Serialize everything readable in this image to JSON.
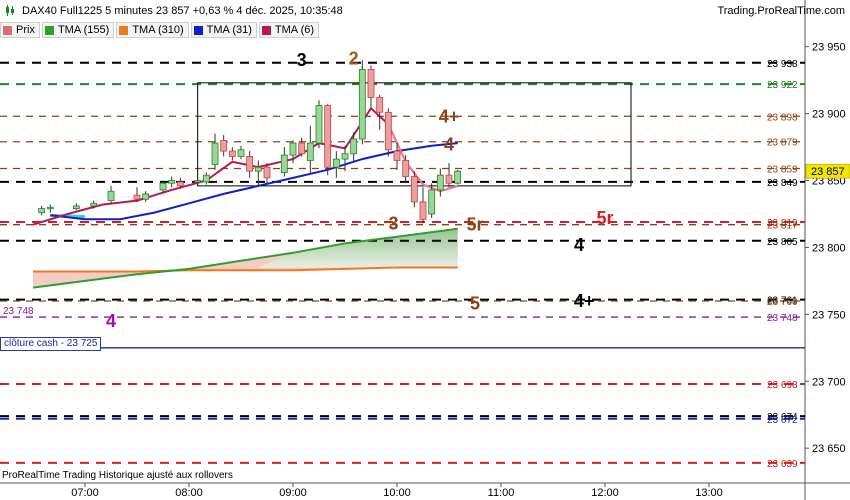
{
  "header": {
    "title": "DAX40 Full1225 5 minutes 23 857 +0,63 % 4 déc. 2025, 10:35:48",
    "brand": "Trading.ProRealTime.com"
  },
  "legend": [
    {
      "label": "Prix",
      "color": "#d97070"
    },
    {
      "label": "TMA (155)",
      "color": "#2e9e2e"
    },
    {
      "label": "TMA (310)",
      "color": "#f07820"
    },
    {
      "label": "TMA (31)",
      "color": "#1020c8"
    },
    {
      "label": "TMA (6)",
      "color": "#b81850"
    }
  ],
  "cash_label": "clôture cash -  23 725",
  "footer": "ProRealTime Trading  Historique ajusté aux rollovers",
  "chart_data": {
    "type": "candlestick",
    "x_ticks": [
      "07:00",
      "08:00",
      "09:00",
      "10:00",
      "11:00",
      "12:00",
      "13:00"
    ],
    "y_ticks": [
      23950,
      23900,
      23850,
      23800,
      23750,
      23700,
      23650
    ],
    "y_tick_labels": [
      "23 950",
      "23 900",
      "23 850",
      "23 800",
      "23 750",
      "23 700",
      "23 650"
    ],
    "ylim": [
      23624,
      23955
    ],
    "last_price": {
      "value": 23857,
      "label": "23 857"
    },
    "candles": [
      {
        "t": "06:35",
        "o": 23826,
        "h": 23831,
        "l": 23824,
        "c": 23829
      },
      {
        "t": "06:40",
        "o": 23829,
        "h": 23832,
        "l": 23826,
        "c": 23830
      },
      {
        "t": "06:55",
        "o": 23829,
        "h": 23833,
        "l": 23828,
        "c": 23831
      },
      {
        "t": "07:05",
        "o": 23831,
        "h": 23835,
        "l": 23829,
        "c": 23833
      },
      {
        "t": "07:15",
        "o": 23835,
        "h": 23846,
        "l": 23833,
        "c": 23842
      },
      {
        "t": "07:30",
        "o": 23839,
        "h": 23845,
        "l": 23834,
        "c": 23836
      },
      {
        "t": "07:35",
        "o": 23836,
        "h": 23842,
        "l": 23834,
        "c": 23840
      },
      {
        "t": "07:45",
        "o": 23843,
        "h": 23850,
        "l": 23841,
        "c": 23848
      },
      {
        "t": "07:50",
        "o": 23848,
        "h": 23853,
        "l": 23845,
        "c": 23850
      },
      {
        "t": "07:55",
        "o": 23849,
        "h": 23852,
        "l": 23844,
        "c": 23846
      },
      {
        "t": "08:05",
        "o": 23849,
        "h": 23852,
        "l": 23847,
        "c": 23850
      },
      {
        "t": "08:10",
        "o": 23849,
        "h": 23856,
        "l": 23847,
        "c": 23854
      },
      {
        "t": "08:15",
        "o": 23862,
        "h": 23885,
        "l": 23858,
        "c": 23878
      },
      {
        "t": "08:20",
        "o": 23880,
        "h": 23884,
        "l": 23868,
        "c": 23872
      },
      {
        "t": "08:25",
        "o": 23872,
        "h": 23875,
        "l": 23865,
        "c": 23868
      },
      {
        "t": "08:30",
        "o": 23868,
        "h": 23876,
        "l": 23866,
        "c": 23873
      },
      {
        "t": "08:35",
        "o": 23868,
        "h": 23872,
        "l": 23852,
        "c": 23857
      },
      {
        "t": "08:40",
        "o": 23857,
        "h": 23865,
        "l": 23846,
        "c": 23860
      },
      {
        "t": "08:45",
        "o": 23860,
        "h": 23863,
        "l": 23848,
        "c": 23852
      },
      {
        "t": "08:55",
        "o": 23856,
        "h": 23875,
        "l": 23853,
        "c": 23869
      },
      {
        "t": "09:00",
        "o": 23869,
        "h": 23880,
        "l": 23863,
        "c": 23878
      },
      {
        "t": "09:05",
        "o": 23878,
        "h": 23882,
        "l": 23868,
        "c": 23870
      },
      {
        "t": "09:10",
        "o": 23865,
        "h": 23891,
        "l": 23855,
        "c": 23878
      },
      {
        "t": "09:15",
        "o": 23878,
        "h": 23910,
        "l": 23874,
        "c": 23906
      },
      {
        "t": "09:20",
        "o": 23906,
        "h": 23907,
        "l": 23854,
        "c": 23860
      },
      {
        "t": "09:25",
        "o": 23860,
        "h": 23872,
        "l": 23852,
        "c": 23866
      },
      {
        "t": "09:30",
        "o": 23866,
        "h": 23876,
        "l": 23857,
        "c": 23870
      },
      {
        "t": "09:35",
        "o": 23870,
        "h": 23886,
        "l": 23864,
        "c": 23881
      },
      {
        "t": "09:40",
        "o": 23881,
        "h": 23940,
        "l": 23877,
        "c": 23933
      },
      {
        "t": "09:45",
        "o": 23933,
        "h": 23936,
        "l": 23905,
        "c": 23912
      },
      {
        "t": "09:50",
        "o": 23912,
        "h": 23914,
        "l": 23888,
        "c": 23901
      },
      {
        "t": "09:55",
        "o": 23901,
        "h": 23904,
        "l": 23868,
        "c": 23873
      },
      {
        "t": "10:00",
        "o": 23872,
        "h": 23878,
        "l": 23858,
        "c": 23865
      },
      {
        "t": "10:05",
        "o": 23865,
        "h": 23869,
        "l": 23848,
        "c": 23853
      },
      {
        "t": "10:10",
        "o": 23853,
        "h": 23857,
        "l": 23830,
        "c": 23834
      },
      {
        "t": "10:15",
        "o": 23834,
        "h": 23845,
        "l": 23818,
        "c": 23821
      },
      {
        "t": "10:20",
        "o": 23825,
        "h": 23848,
        "l": 23822,
        "c": 23843
      },
      {
        "t": "10:25",
        "o": 23843,
        "h": 23859,
        "l": 23838,
        "c": 23854
      },
      {
        "t": "10:30",
        "o": 23854,
        "h": 23863,
        "l": 23845,
        "c": 23848
      },
      {
        "t": "10:35",
        "o": 23848,
        "h": 23858,
        "l": 23847,
        "c": 23857
      }
    ],
    "tma6": [
      [
        "06:30",
        23817
      ],
      [
        "06:50",
        23825
      ],
      [
        "07:10",
        23832
      ],
      [
        "07:30",
        23835
      ],
      [
        "07:50",
        23843
      ],
      [
        "08:10",
        23850
      ],
      [
        "08:25",
        23864
      ],
      [
        "08:40",
        23860
      ],
      [
        "09:00",
        23866
      ],
      [
        "09:15",
        23878
      ],
      [
        "09:30",
        23874
      ],
      [
        "09:45",
        23904
      ],
      [
        "09:55",
        23892
      ],
      [
        "10:05",
        23864
      ],
      [
        "10:15",
        23847
      ],
      [
        "10:25",
        23842
      ],
      [
        "10:35",
        23846
      ]
    ],
    "tma31": [
      [
        "06:40",
        23824
      ],
      [
        "07:00",
        23821
      ],
      [
        "07:20",
        23821
      ],
      [
        "07:40",
        23826
      ],
      [
        "08:00",
        23833
      ],
      [
        "08:20",
        23840
      ],
      [
        "08:40",
        23846
      ],
      [
        "09:00",
        23852
      ],
      [
        "09:20",
        23858
      ],
      [
        "09:40",
        23866
      ],
      [
        "10:00",
        23872
      ],
      [
        "10:20",
        23876
      ],
      [
        "10:35",
        23878
      ]
    ],
    "tma155": [
      [
        "06:30",
        23770
      ],
      [
        "07:00",
        23775
      ],
      [
        "07:30",
        23780
      ],
      [
        "08:00",
        23784
      ],
      [
        "08:30",
        23790
      ],
      [
        "09:00",
        23796
      ],
      [
        "09:30",
        23803
      ],
      [
        "10:00",
        23808
      ],
      [
        "10:35",
        23814
      ]
    ],
    "tma310": [
      [
        "06:30",
        23782
      ],
      [
        "07:00",
        23782
      ],
      [
        "07:30",
        23782
      ],
      [
        "08:00",
        23783
      ],
      [
        "08:30",
        23783
      ],
      [
        "09:00",
        23783
      ],
      [
        "09:30",
        23784
      ],
      [
        "10:00",
        23785
      ],
      [
        "10:35",
        23785
      ]
    ],
    "tma310_fill_color": "#f3c3ba",
    "tma155_fill_color": "#8cc48c",
    "levels": [
      {
        "y": 23938,
        "label": "23 938",
        "color": "#000000",
        "dash": "long",
        "label_color": "#000000"
      },
      {
        "y": 23922,
        "label": "23 922",
        "color": "#1a8a1a",
        "dash": "long",
        "label_color": "#1a7a1a"
      },
      {
        "y": 23898,
        "label": "23 898",
        "color": "#8b4513",
        "dash": "mid",
        "label_color": "#8b4513"
      },
      {
        "y": 23879,
        "label": "23 879",
        "color": "#8b4513",
        "dash": "mid",
        "label_color": "#8b4513"
      },
      {
        "y": 23859,
        "label": "23 859",
        "color": "#8b4513",
        "dash": "mid",
        "label_color": "#8b4513"
      },
      {
        "y": 23849,
        "label": "23 849",
        "color": "#000000",
        "dash": "long",
        "label_color": "#000000"
      },
      {
        "y": 23819,
        "label": "23 819",
        "color": "#d42020",
        "dash": "long",
        "label_color": "#c81818"
      },
      {
        "y": 23817,
        "label": "23 817",
        "color": "#8b4513",
        "dash": "mid",
        "label_color": "#8b4513"
      },
      {
        "y": 23805,
        "label": "23 805",
        "color": "#000000",
        "dash": "long",
        "label_color": "#000000"
      },
      {
        "y": 23761,
        "label": "23 761",
        "color": "#000000",
        "dash": "long",
        "label_color": "#000000"
      },
      {
        "y": 23760,
        "label": "23 760",
        "color": "#8b4513",
        "dash": "mid",
        "label_color": "#8b4513"
      },
      {
        "y": 23748,
        "label": "23 748",
        "color": "#8b1aa0",
        "dash": "mid",
        "label_color": "#8b1aa0"
      },
      {
        "y": 23725,
        "label": "",
        "color": "#1a2ab8",
        "dash": "solid",
        "label_color": "#1a2ab8"
      },
      {
        "y": 23698,
        "label": "23 698",
        "color": "#d42020",
        "dash": "long",
        "label_color": "#c81818"
      },
      {
        "y": 23674,
        "label": "23 674",
        "color": "#000000",
        "dash": "long",
        "label_color": "#000000"
      },
      {
        "y": 23672,
        "label": "23 672",
        "color": "#1a2ab8",
        "dash": "long",
        "label_color": "#1a2ab8"
      },
      {
        "y": 23639,
        "label": "23 639",
        "color": "#d42020",
        "dash": "long",
        "label_color": "#c81818"
      }
    ],
    "left_label": {
      "text": "23 748",
      "y": 23748,
      "color": "#8b1aa0"
    },
    "annotations": [
      {
        "text": "3",
        "t": "09:05",
        "y": 23940,
        "color": "#000000"
      },
      {
        "text": "2",
        "t": "09:35",
        "y": 23941,
        "color": "#a05a18"
      },
      {
        "text": "4+",
        "t": "10:30",
        "y": 23898,
        "color": "#8b4513"
      },
      {
        "text": "4",
        "t": "10:30",
        "y": 23877,
        "color": "#8b4513"
      },
      {
        "text": "3",
        "t": "09:58",
        "y": 23818,
        "color": "#8b4513"
      },
      {
        "text": "5r",
        "t": "10:45",
        "y": 23817,
        "color": "#8b4513"
      },
      {
        "text": "5r",
        "t": "12:00",
        "y": 23822,
        "color": "#d42020"
      },
      {
        "text": "4",
        "t": "11:45",
        "y": 23802,
        "color": "#000000"
      },
      {
        "text": "4+",
        "t": "11:48",
        "y": 23760,
        "color": "#000000"
      },
      {
        "text": "5",
        "t": "10:45",
        "y": 23758,
        "color": "#8b4513"
      },
      {
        "text": "4",
        "t": "07:15",
        "y": 23745,
        "color": "#8b1aa0"
      }
    ],
    "box": {
      "t1": "08:05",
      "t2": "12:15",
      "y1": 23846,
      "y2": 23923
    }
  }
}
